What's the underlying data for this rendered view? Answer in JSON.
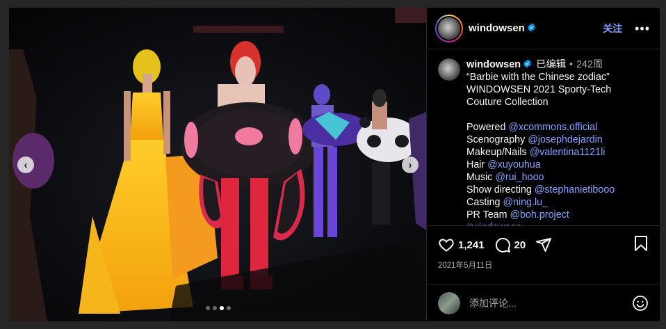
{
  "post": {
    "username": "windowsen",
    "follow_label": "关注",
    "more_label": "•••"
  },
  "caption": {
    "username": "windowsen",
    "edited": "已编辑",
    "separator": "•",
    "age": "242周",
    "lines": [
      {
        "text": "“Barbie with the Chinese zodiac”",
        "mention": ""
      },
      {
        "text": "WINDOWSEN 2021 Sporty-Tech",
        "mention": ""
      },
      {
        "text": "Couture Collection",
        "mention": ""
      },
      {
        "text": "Powered ",
        "mention": "@xcommons.official"
      },
      {
        "text": "Scenography ",
        "mention": "@josephdejardin"
      },
      {
        "text": "Makeup/Nails ",
        "mention": "@valentina1121li"
      },
      {
        "text": "Hair ",
        "mention": "@xuyouhua"
      },
      {
        "text": "Music ",
        "mention": "@rui_hooo"
      },
      {
        "text": "Show directing ",
        "mention": "@stephanietibooo"
      },
      {
        "text": "Casting ",
        "mention": "@ning.lu_"
      },
      {
        "text": "PR Team ",
        "mention": "@boh.project"
      },
      {
        "text": "",
        "mention": "#windowsen"
      }
    ]
  },
  "stats": {
    "likes": "1,241",
    "comments": "20",
    "date": "2021年5月11日"
  },
  "comment": {
    "placeholder": "添加评论..."
  },
  "carousel": {
    "prev_icon": "‹",
    "next_icon": "›",
    "dot_count": 4,
    "active_index": 2
  },
  "colors": {
    "accent": "#85a1ff",
    "verified": "#0095f6",
    "background": "#000000"
  },
  "icons": [
    "heart-icon",
    "comment-icon",
    "share-icon",
    "bookmark-icon",
    "emoji-icon",
    "verified-badge-icon",
    "chevron-left-icon",
    "chevron-right-icon"
  ]
}
